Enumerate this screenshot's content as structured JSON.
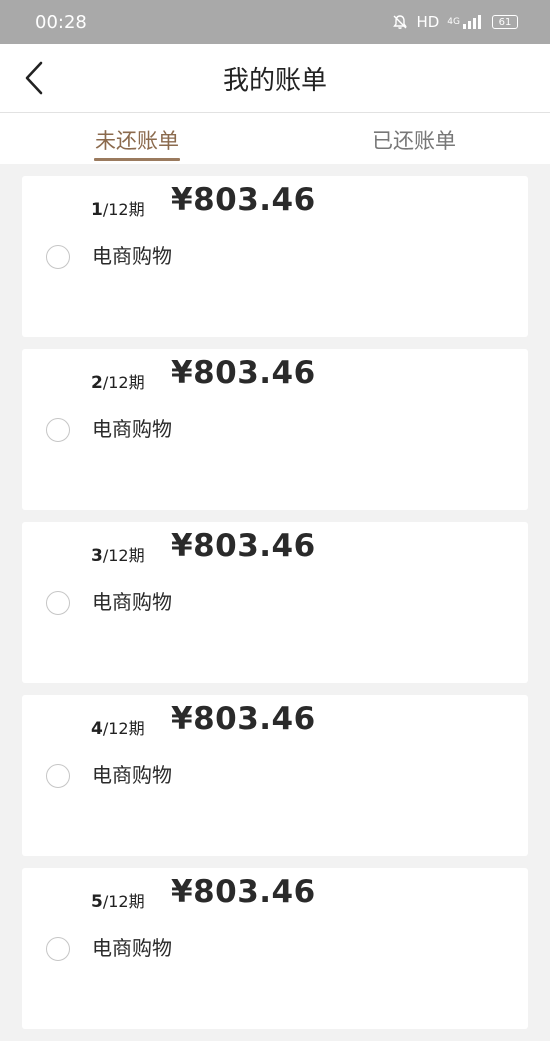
{
  "status_bar": {
    "time": "00:28",
    "network": "HD",
    "signal_label": "4G",
    "battery": "61"
  },
  "nav": {
    "title": "我的账单"
  },
  "tabs": [
    {
      "label": "未还账单",
      "active": true
    },
    {
      "label": "已还账单",
      "active": false
    }
  ],
  "bills": [
    {
      "period_num": "1",
      "period_total": "/12期",
      "amount": "¥803.46",
      "category": "电商购物"
    },
    {
      "period_num": "2",
      "period_total": "/12期",
      "amount": "¥803.46",
      "category": "电商购物"
    },
    {
      "period_num": "3",
      "period_total": "/12期",
      "amount": "¥803.46",
      "category": "电商购物"
    },
    {
      "period_num": "4",
      "period_total": "/12期",
      "amount": "¥803.46",
      "category": "电商购物"
    },
    {
      "period_num": "5",
      "period_total": "/12期",
      "amount": "¥803.46",
      "category": "电商购物"
    }
  ],
  "colors": {
    "accent": "#8b6a4d",
    "status_bar_bg": "#a9a9a9",
    "page_bg": "#f2f2f2"
  }
}
